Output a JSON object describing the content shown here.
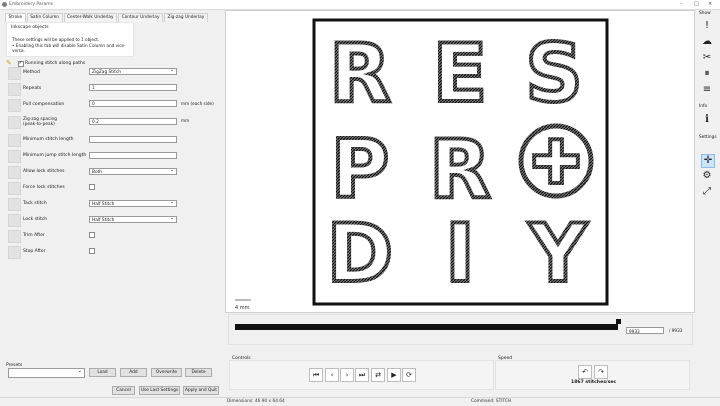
{
  "window": {
    "title": "Embroidery Params",
    "minimize": "–",
    "maximize": "□",
    "close": "×"
  },
  "tabs": [
    "Stroke",
    "Satin Column",
    "Center-Walk Underlay",
    "Contour Underlay",
    "Zig-zag Underlay"
  ],
  "info": {
    "title": "Inkscape objects",
    "line1": "These settings will be applied to 1 object.",
    "line2": "• Enabling this tab will disable Satin Column and vice-versa."
  },
  "running_stitch": {
    "label": "Running stitch along paths",
    "checked": true
  },
  "params": [
    {
      "label": "Method",
      "type": "select",
      "value": "ZigZag Stitch",
      "unit": ""
    },
    {
      "label": "Repeats",
      "type": "text",
      "value": "1",
      "unit": ""
    },
    {
      "label": "Pull compensation",
      "type": "text",
      "value": "0",
      "unit": "mm (each side)"
    },
    {
      "label": "Zig-zag spacing\n(peak-to-peak)",
      "type": "text",
      "value": "0.2",
      "unit": "mm"
    },
    {
      "label": "Minimum stitch length",
      "type": "text",
      "value": "",
      "unit": ""
    },
    {
      "label": "Minimum jump stitch length",
      "type": "text",
      "value": "",
      "unit": ""
    },
    {
      "label": "Allow lock stitches",
      "type": "select",
      "value": "Both",
      "unit": ""
    },
    {
      "label": "Force lock stitches",
      "type": "checkbox",
      "value": "",
      "unit": ""
    },
    {
      "label": "Tack stitch",
      "type": "select",
      "value": "Half Stitch",
      "unit": ""
    },
    {
      "label": "Lock stitch",
      "type": "select",
      "value": "Half Stitch",
      "unit": ""
    },
    {
      "label": "Trim After",
      "type": "checkbox",
      "value": "",
      "unit": ""
    },
    {
      "label": "Stop After",
      "type": "checkbox",
      "value": "",
      "unit": ""
    }
  ],
  "presets": {
    "label": "Presets",
    "value": "",
    "load": "Load",
    "add": "Add",
    "overwrite": "Overwrite",
    "delete": "Delete"
  },
  "footer_buttons": {
    "cancel": "Cancel",
    "use_last": "Use Last Settings",
    "apply_quit": "Apply and Quit"
  },
  "canvas": {
    "letters": [
      "R",
      "E",
      "S",
      "P",
      "R",
      "✚",
      "D",
      "I",
      "Y"
    ],
    "scale_label": "4 mm"
  },
  "simulator": {
    "progress": 1.0,
    "current_frame": "9933",
    "total_frames": "/ 9933",
    "controls_label": "Controls",
    "controls": [
      "⏮",
      "‹",
      "›",
      "⏭",
      "⇄",
      "▶",
      "⟳"
    ],
    "speed_label": "Speed",
    "speed_value": "1867 stitches/sec"
  },
  "status": {
    "dimensions": "Dimensions: 46.90 x 64.64",
    "command": "Command: STITCH"
  },
  "sidebar": {
    "show_label": "Show",
    "show_icons": [
      "!",
      "☁",
      "✂",
      "⏸",
      "≡"
    ],
    "info_label": "Info",
    "info_icon": "i",
    "settings_label": "Settings",
    "settings_icons": [
      "✛",
      "⚙",
      "⤢"
    ]
  }
}
